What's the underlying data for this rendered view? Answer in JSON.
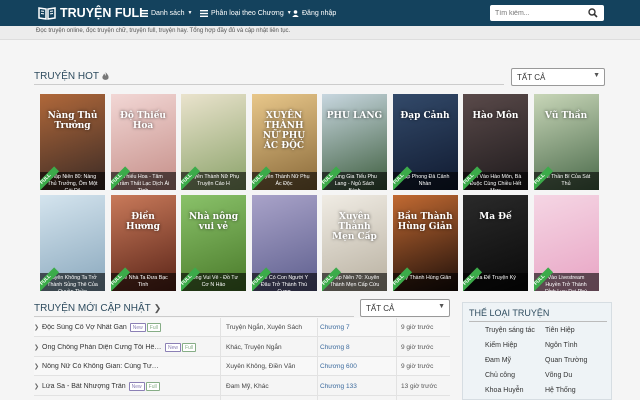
{
  "header": {
    "logo": "TRUYỆN FULL",
    "nav": [
      {
        "label": "Danh sách"
      },
      {
        "label": "Phân loại theo Chương"
      },
      {
        "label": "Đăng nhập"
      }
    ],
    "search_placeholder": "Tìm kiếm..."
  },
  "tagline": "Đọc truyện online, đọc truyện chữ, truyện full, truyện hay. Tổng hợp đầy đủ và cập nhật liên tục.",
  "hot": {
    "title": "TRUYỆN HOT",
    "filter": "TẤT CẢ",
    "full_label": "FULL",
    "items": [
      {
        "caption": "Thập Niên 80: Nàng Thủ Trưởng, Ôm Một Cái Đi!",
        "art": "Nàng Thủ Trưởng",
        "color1": "#b0683a",
        "color2": "#3a2a25"
      },
      {
        "caption": "Thiếu Hoa - Tâm Trầm Thất Lạc Dịch Ái Tình",
        "art": "Độ Thiếu Hoa",
        "color1": "#f2d7d5",
        "color2": "#c58e88"
      },
      {
        "caption": "Xuyên Thành Nữ Phụ Truyện Cáo H",
        "art": "",
        "color1": "#eae3cd",
        "color2": "#8aa269"
      },
      {
        "caption": "Xuyên Thành Nữ Phụ Ác Độc",
        "art": "XUYÊN THÀNH NỮ PHỤ ÁC ĐỘC",
        "color1": "#e8c78a",
        "color2": "#8a6a3a"
      },
      {
        "caption": "Cùng Gia Tiểu Phu Lang - Ngủ Sách Bách",
        "art": "PHU LANG",
        "color1": "#c8d7e0",
        "color2": "#3d5d3d"
      },
      {
        "caption": "Đạp Phong Đả Cảnh Nhàn",
        "art": "Đạp Cảnh",
        "color1": "#334a6a",
        "color2": "#101a30"
      },
      {
        "caption": "Chí Vào Hào Môn, Bà Đuộc Cùng Chiều Hết Mực",
        "art": "Hào Môn",
        "color1": "#5a4a4a",
        "color2": "#1e1a1c"
      },
      {
        "caption": "Khí Thần Bí Của Sát Thủ",
        "art": "Vũ Thần",
        "color1": "#c8d6b8",
        "color2": "#4a6a4a"
      },
      {
        "caption": "Xuyên Không Ta Trở Thành Sủng Thê Của Quyền Thần",
        "art": "",
        "color1": "#d4e4ee",
        "color2": "#8aa8bd"
      },
      {
        "caption": "Thế Nhà Ta Đưa Bạc Tình",
        "art": "Điền Hương",
        "color1": "#c97a5a",
        "color2": "#5a2418"
      },
      {
        "caption": "Nông Vui Vẻ - Đồ Tư Cơ N Hảo",
        "art": "Nhà nông vui vẻ",
        "color1": "#8ac26a",
        "color2": "#4a7a2a"
      },
      {
        "caption": "Khi Có Con Người Y Đâu Trở Thành Thú Cưng",
        "art": "",
        "color1": "#a9a3c9",
        "color2": "#5e5f8e"
      },
      {
        "caption": "Thập Niên 70: Xuyên Thành Mẹn Cấp Cứu",
        "art": "Xuyên Thành Mẹn Cấp",
        "color1": "#f0ece4",
        "color2": "#b8b0a0"
      },
      {
        "caption": "Đây Thành Hùng Giản",
        "art": "Bầu Thành Hùng Giản",
        "color1": "#c26a32",
        "color2": "#1e0f0a"
      },
      {
        "caption": "Ma Để Truyện Ký",
        "art": "Ma Đế",
        "color1": "#2a2a2a",
        "color2": "#0a0a0a"
      },
      {
        "caption": "Vào Livestream Huyền Trở Thành Đỉnh Lưu Đại Phú",
        "art": "",
        "color1": "#f5d6e4",
        "color2": "#e8a4c4"
      }
    ]
  },
  "latest": {
    "title": "TRUYỆN MỚI CẬP NHẬT",
    "filter": "TẤT CẢ",
    "badge_new": "New",
    "badge_full": "Full",
    "rows": [
      {
        "title": "Độc Sủng Cô Vợ Nhất Gan",
        "badges": [
          "New",
          "Full"
        ],
        "genres": "Truyện Ngắn, Xuyên Sách",
        "chapter": "Chương 7",
        "time": "9 giờ trước"
      },
      {
        "title": "Ông Chồng Phản Diện Cưng Tôi Hết Mực",
        "badges": [
          "New",
          "Full"
        ],
        "genres": "Khác, Truyện Ngắn",
        "chapter": "Chương 8",
        "time": "9 giờ trước"
      },
      {
        "title": "Nông Nữ Có Không Gian: Cùng Tướng Công Thợ Săn ...",
        "badges": [],
        "genres": "Xuyên Không, Điền Văn",
        "chapter": "Chương 600",
        "time": "9 giờ trước"
      },
      {
        "title": "Lửa Sa - Bất Nhượng Trần",
        "badges": [
          "New",
          "Full"
        ],
        "genres": "Đam Mỹ, Khác",
        "chapter": "Chương 133",
        "time": "13 giờ trước"
      }
    ]
  },
  "genres": {
    "title": "THỂ LOẠI TRUYỆN",
    "items": [
      "Truyện sáng tác",
      "Tiên Hiệp",
      "Kiếm Hiệp",
      "Ngôn Tình",
      "Đam Mỹ",
      "Quan Trường",
      "Chủ công",
      "Võng Du",
      "Khoa Huyễn",
      "Hệ Thống"
    ]
  }
}
